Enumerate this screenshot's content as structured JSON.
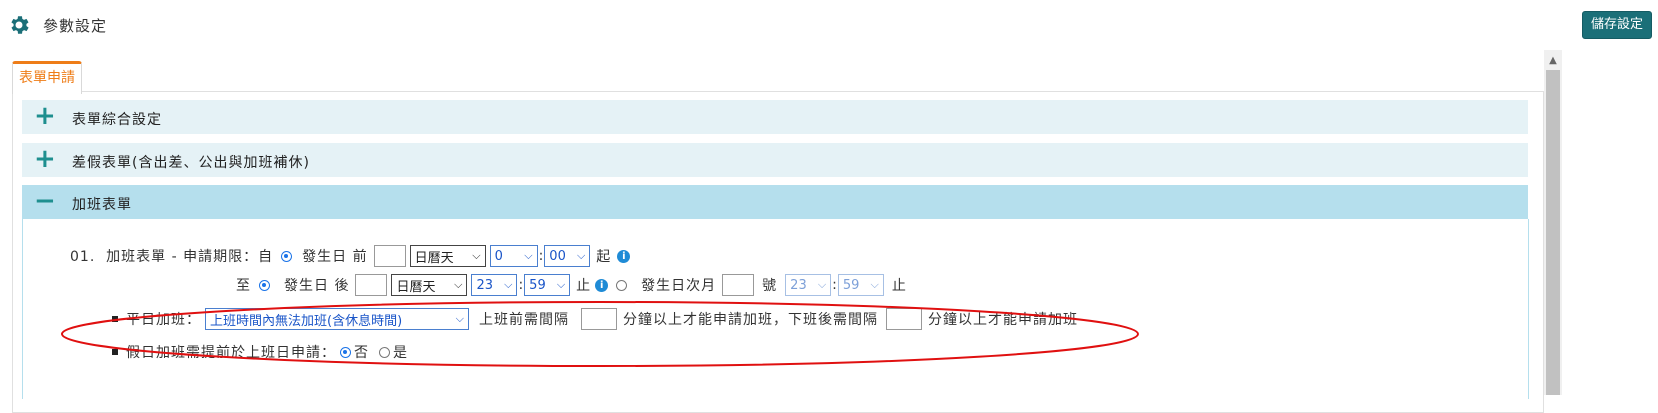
{
  "header": {
    "title": "參數設定",
    "save_label": "儲存設定"
  },
  "tabs": [
    {
      "label": "表單申請",
      "active": true
    }
  ],
  "sections": [
    {
      "title": "表單綜合設定",
      "icon": "+",
      "expanded": false
    },
    {
      "title": "差假表單(含出差、公出與加班補休)",
      "icon": "+",
      "expanded": false
    },
    {
      "title": "加班表單",
      "icon": "−",
      "expanded": true
    }
  ],
  "overtime": {
    "r1": {
      "prefix": "01.  加班表單 - 申請期限：自",
      "ref_day": "發生日 前",
      "unit": "日曆天",
      "hour": "0",
      "colon": ":",
      "minute": "00",
      "suffix": "起"
    },
    "r2": {
      "prefix": "至",
      "ref_day": "發生日 後",
      "unit": "日曆天",
      "hour": "23",
      "colon": ":",
      "minute": "59",
      "stop": "止",
      "next_month": "發生日次月",
      "day_label": "號",
      "hour2": "23",
      "colon2": ":",
      "minute2": "59",
      "stop2": "止"
    },
    "r3": {
      "label": "平日加班：",
      "option": "上班時間內無法加班(含休息時間)",
      "before_gap": "上班前需間隔",
      "before_text": "分鐘以上才能申請加班，下班後需間隔",
      "after_text": "分鐘以上才能申請加班"
    },
    "r4": {
      "label": "假日加班需提前於上班日申請：",
      "no_label": "否",
      "yes_label": "是",
      "selected": "否"
    }
  },
  "colors": {
    "accent_tab": "#ee7d18",
    "save_button": "#1b6f78",
    "section_header": "#e5f2f6",
    "section_header_expanded": "#b5dfed",
    "annotation": "#e01010"
  },
  "icons": {
    "page_icon": "gear-icon",
    "info_icon": "info-icon"
  }
}
